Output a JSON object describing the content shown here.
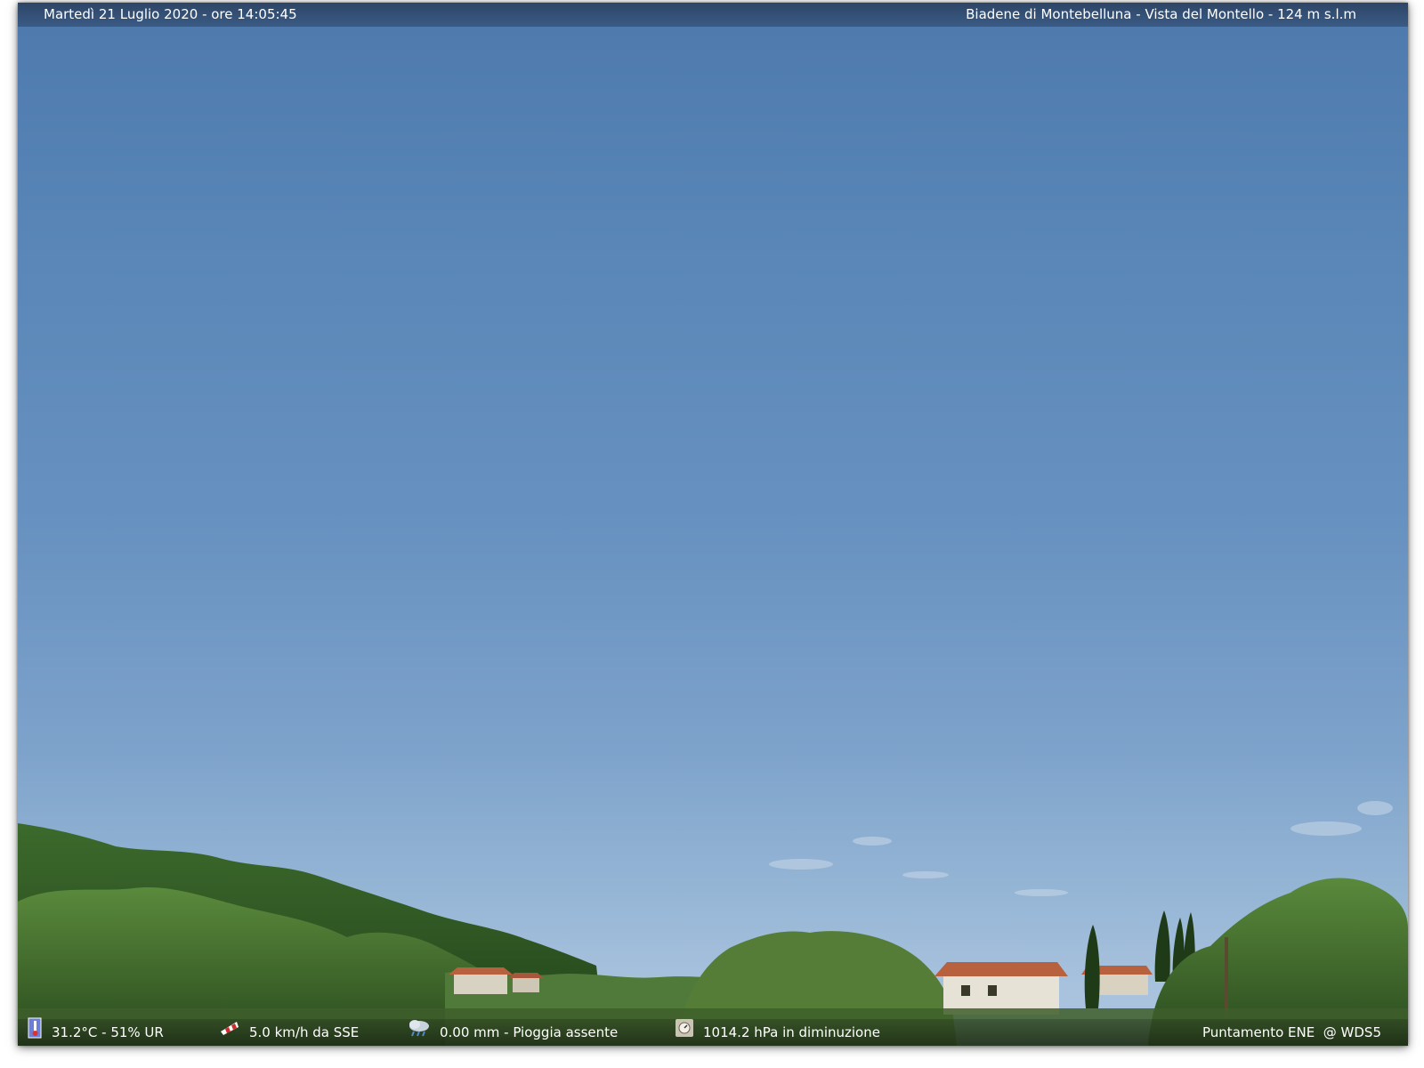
{
  "header": {
    "datetime": "Martedì 21 Luglio 2020 - ore 14:05:45",
    "location": "Biadene di Montebelluna - Vista del Montello - 124 m s.l.m"
  },
  "footer": {
    "temperature": "31.2°C - 51% UR",
    "wind": "5.0 km/h da SSE",
    "rain": "0.00 mm - Pioggia assente",
    "pressure": "1014.2 hPa in diminuzione",
    "pointing": "Puntamento ENE  @ WDS5"
  },
  "icons": {
    "temperature": "thermometer-icon",
    "wind": "windsock-icon",
    "rain": "rain-cloud-icon",
    "pressure": "barometer-icon"
  },
  "colors": {
    "sky_top": "#4d79ad",
    "sky_horizon": "#a9c3de",
    "hill": "#2f5a24",
    "foliage": "#4c7a32",
    "roof": "#b8613f",
    "house_wall": "#e6e2d6"
  }
}
